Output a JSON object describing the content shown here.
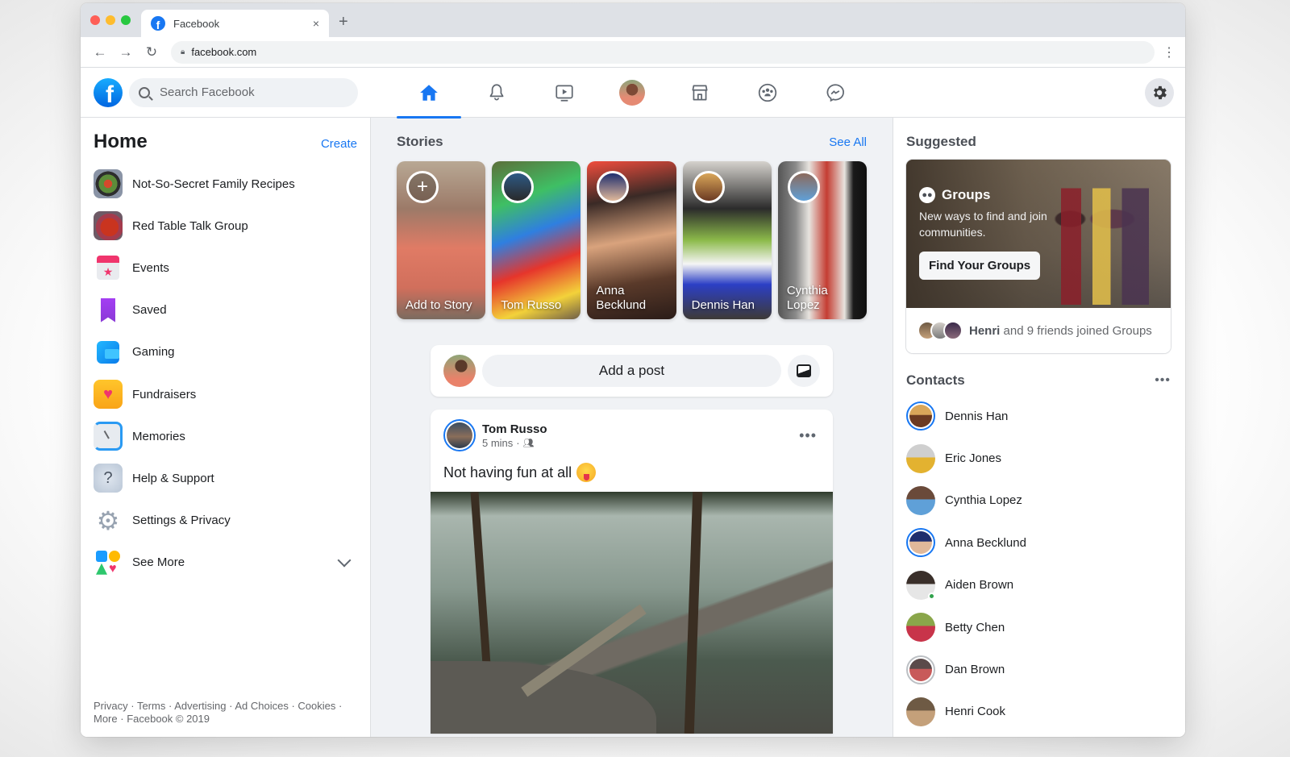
{
  "browser": {
    "tab_title": "Facebook",
    "tab_favicon": "facebook-f",
    "new_tab": "+",
    "close_tab": "×",
    "url": "facebook.com",
    "nav": {
      "back": "←",
      "forward": "→",
      "reload": "↻"
    },
    "menu": "⋮"
  },
  "topnav": {
    "logo": "f",
    "search_placeholder": "Search Facebook",
    "icons": [
      {
        "name": "home",
        "active": true
      },
      {
        "name": "notifications",
        "active": false
      },
      {
        "name": "watch",
        "active": false
      },
      {
        "name": "profile",
        "active": false
      },
      {
        "name": "marketplace",
        "active": false
      },
      {
        "name": "groups",
        "active": false
      },
      {
        "name": "messenger",
        "active": false
      }
    ],
    "settings_icon": "gear"
  },
  "left": {
    "title": "Home",
    "create": "Create",
    "items": [
      {
        "label": "Not-So-Secret Family Recipes",
        "icon": "group-recipes"
      },
      {
        "label": "Red Table Talk Group",
        "icon": "group-red-table"
      },
      {
        "label": "Events",
        "icon": "events",
        "glyph": "★"
      },
      {
        "label": "Saved",
        "icon": "saved"
      },
      {
        "label": "Gaming",
        "icon": "gaming"
      },
      {
        "label": "Fundraisers",
        "icon": "fundraisers",
        "glyph": "♥"
      },
      {
        "label": "Memories",
        "icon": "memories"
      },
      {
        "label": "Help & Support",
        "icon": "help",
        "glyph": "?"
      },
      {
        "label": "Settings & Privacy",
        "icon": "settings",
        "glyph": "⚙"
      },
      {
        "label": "See More",
        "icon": "see-more",
        "glyph": "♥"
      }
    ],
    "footer": {
      "links": [
        "Privacy",
        "Terms",
        "Advertising",
        "Ad Choices",
        "Cookies",
        "More"
      ],
      "copyright": "Facebook © 2019",
      "separator": " · "
    }
  },
  "center": {
    "stories_title": "Stories",
    "see_all": "See All",
    "stories": [
      {
        "name": "Add to Story",
        "add": true,
        "glyph": "+"
      },
      {
        "name": "Tom Russo"
      },
      {
        "name": "Anna Becklund"
      },
      {
        "name": "Dennis Han"
      },
      {
        "name": "Cynthia Lopez"
      }
    ],
    "composer_placeholder": "Add a post",
    "post": {
      "author": "Tom Russo",
      "time": "5 mins",
      "dot": "·",
      "audience_icon": "friends",
      "more": "•••",
      "text": "Not having fun at all",
      "emoji": "winking-tongue-face"
    }
  },
  "right": {
    "suggested_title": "Suggested",
    "groups": {
      "title": "Groups",
      "description": "New ways to find and join communities.",
      "button": "Find Your Groups",
      "footer_name": "Henri",
      "footer_text": " and 9 friends joined Groups"
    },
    "contacts_title": "Contacts",
    "contacts_more": "•••",
    "contacts": [
      {
        "name": "Dennis Han",
        "ring": "story",
        "online": false,
        "colors": [
          "#d9a65a",
          "#6b3a22"
        ]
      },
      {
        "name": "Eric Jones",
        "ring": "none",
        "online": false,
        "colors": [
          "#cfcfcf",
          "#e3b230"
        ]
      },
      {
        "name": "Cynthia Lopez",
        "ring": "none",
        "online": false,
        "colors": [
          "#6a4a3a",
          "#5fa0d8"
        ]
      },
      {
        "name": "Anna Becklund",
        "ring": "story",
        "online": false,
        "colors": [
          "#1f2e6e",
          "#e0b89a"
        ]
      },
      {
        "name": "Aiden Brown",
        "ring": "none",
        "online": true,
        "colors": [
          "#3a2f2a",
          "#e6e6e6"
        ]
      },
      {
        "name": "Betty Chen",
        "ring": "none",
        "online": false,
        "colors": [
          "#8aa64a",
          "#c8344a"
        ]
      },
      {
        "name": "Dan Brown",
        "ring": "seen",
        "online": false,
        "colors": [
          "#5a4a4a",
          "#c85a5a"
        ]
      },
      {
        "name": "Henri Cook",
        "ring": "none",
        "online": false,
        "colors": [
          "#6e5a44",
          "#c4a07a"
        ]
      }
    ]
  },
  "colors": {
    "brand": "#1877f2",
    "feed_bg": "#f0f2f5",
    "online": "#31a24c"
  }
}
